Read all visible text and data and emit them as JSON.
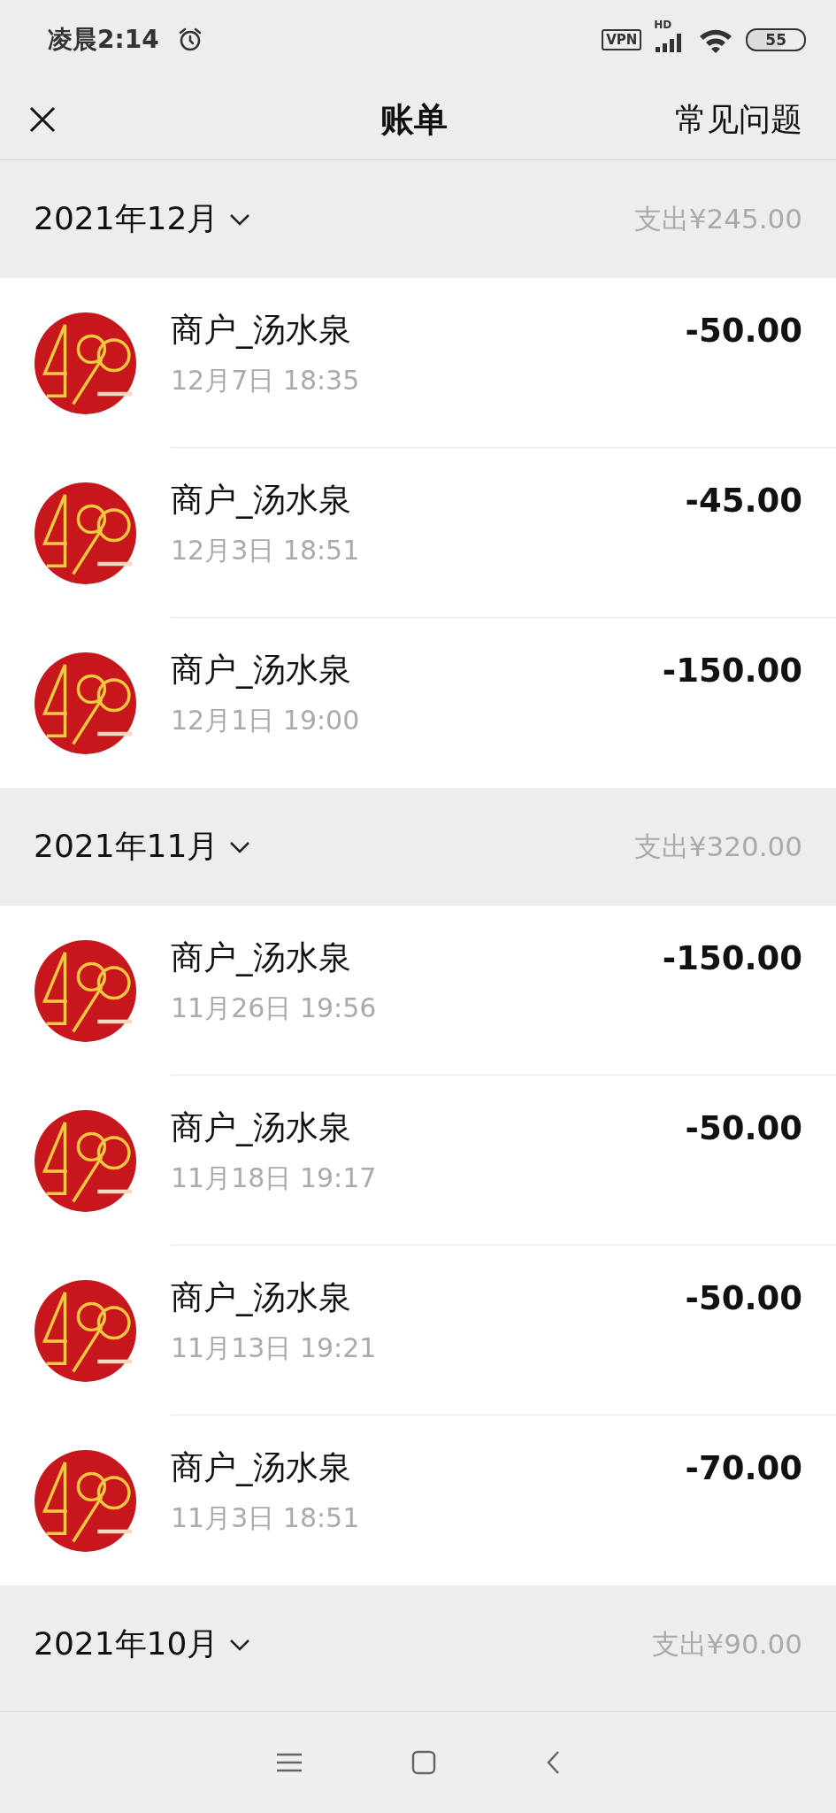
{
  "status_bar": {
    "time": "凌晨2:14",
    "vpn": "VPN",
    "network": "HD",
    "battery": "55"
  },
  "header": {
    "title": "账单",
    "action": "常见问题"
  },
  "months": [
    {
      "label": "2021年12月",
      "spent": "支出¥245.00",
      "items": [
        {
          "name": "商户_汤水泉",
          "time": "12月7日 18:35",
          "amount": "-50.00"
        },
        {
          "name": "商户_汤水泉",
          "time": "12月3日 18:51",
          "amount": "-45.00"
        },
        {
          "name": "商户_汤水泉",
          "time": "12月1日 19:00",
          "amount": "-150.00"
        }
      ]
    },
    {
      "label": "2021年11月",
      "spent": "支出¥320.00",
      "items": [
        {
          "name": "商户_汤水泉",
          "time": "11月26日 19:56",
          "amount": "-150.00"
        },
        {
          "name": "商户_汤水泉",
          "time": "11月18日 19:17",
          "amount": "-50.00"
        },
        {
          "name": "商户_汤水泉",
          "time": "11月13日 19:21",
          "amount": "-50.00"
        },
        {
          "name": "商户_汤水泉",
          "time": "11月3日 18:51",
          "amount": "-70.00"
        }
      ]
    },
    {
      "label": "2021年10月",
      "spent": "支出¥90.00"
    }
  ]
}
